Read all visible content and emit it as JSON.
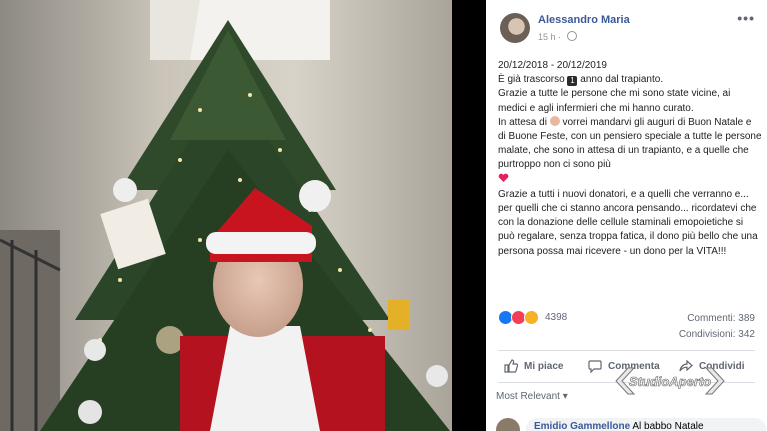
{
  "post": {
    "author": "Alessandro Maria",
    "time": "15 h",
    "menu": "•••",
    "lines": [
      "20/12/2018 - 20/12/2019",
      "È già trascorso [1] anno dal trapianto.",
      "Grazie a tutte le persone che mi sono state vicine, ai medici e agli infermieri che mi hanno curato.",
      "In attesa di [babbo-natale] vorrei mandarvi gli auguri di Buon Natale e di Buone Feste, con un pensiero speciale a tutte le persone malate, che sono in attesa di un trapianto, e a quelle che purtroppo non ci sono più",
      "[heart]",
      "Grazie a tutti i nuovi donatori, e a quelli che verranno e... per quelli che ci stanno ancora pensando... ricordatevi che con la donazione delle cellule staminali emopoietiche si può regalare, senza troppa fatica, il dono più bello che una persona possa mai ricevere - un dono per la VITA!!!"
    ],
    "text": {
      "date_range": "20/12/2018 - 20/12/2019",
      "line1_a": "È già trascorso",
      "line1_b": "anno dal trapianto.",
      "line2": "Grazie a tutte le persone che mi sono state vicine, ai medici e agli infermieri che mi hanno curato.",
      "line3_a": "In attesa di",
      "line3_b": "vorrei mandarvi gli auguri di Buon Natale e di Buone Feste, con un pensiero speciale a tutte le persone malate, che sono in attesa di un trapianto, e a quelle che purtroppo non ci sono più",
      "line4": "Grazie a tutti i nuovi donatori, e a quelli che verranno e... per quelli che ci stanno ancora pensando... ricordatevi che con la donazione delle cellule staminali emopoietiche si può regalare, senza troppa fatica, il dono più bello che una persona possa mai ricevere - un dono per la VITA!!!"
    },
    "emoji": {
      "one_icon": "keycap-one-icon",
      "santa_icon": "santa-claus-icon",
      "heart_icon": "red-heart-icon"
    },
    "reactions": {
      "count": "4398",
      "icons": [
        "like-icon",
        "love-icon",
        "wow-icon"
      ],
      "colors": {
        "like": "#1877f2",
        "love": "#f33e58",
        "wow": "#f7b125"
      }
    },
    "stats": {
      "comments": "Commenti: 389",
      "shares": "Condivisioni: 342"
    },
    "actions": {
      "like": "Mi piace",
      "comment": "Commenta",
      "share": "Condividi"
    },
    "sort": "Most Relevant",
    "comment_preview": {
      "name": "Emidio Gammellone",
      "text": "Al babbo Natale"
    }
  },
  "watermark": "StudioAperto",
  "colors": {
    "link": "#3b5998",
    "secondary": "#606770",
    "background": "#000000"
  }
}
